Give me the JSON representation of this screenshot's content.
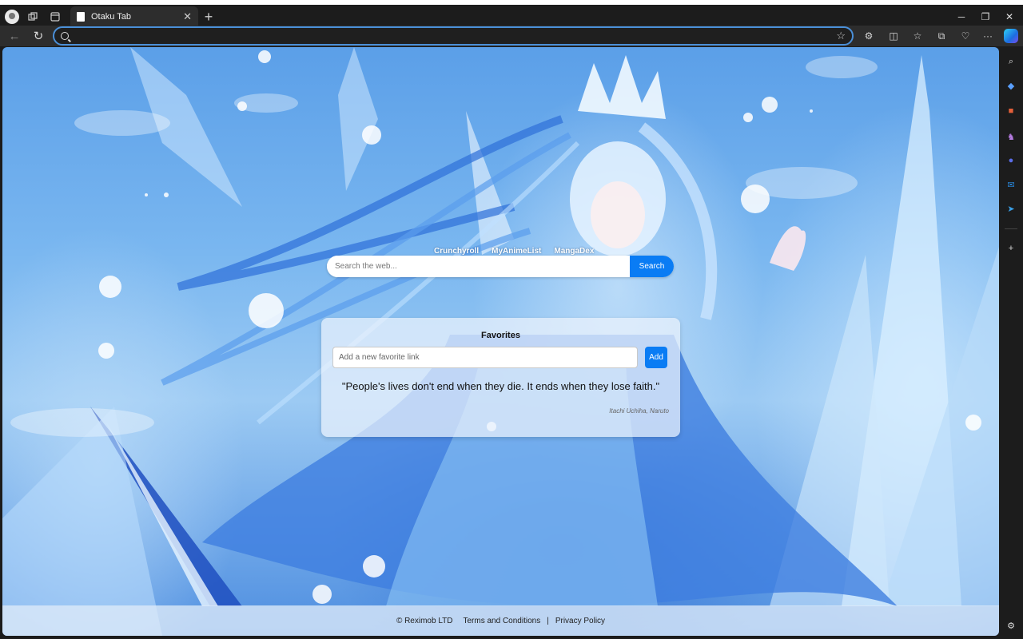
{
  "tab": {
    "title": "Otaku Tab"
  },
  "address_bar": {
    "value": ""
  },
  "page": {
    "quick_links": [
      "Crunchyroll",
      "MyAnimeList",
      "MangaDex"
    ],
    "search": {
      "placeholder": "Search the web...",
      "button": "Search"
    },
    "favorites": {
      "title": "Favorites",
      "input_placeholder": "Add a new favorite link",
      "add_button": "Add"
    },
    "quote": {
      "text": "\"People's lives don't end when they die. It ends when they lose faith.\"",
      "author": "Itachi Uchiha, Naruto"
    },
    "footer": {
      "copyright": "© Reximob LTD",
      "terms": "Terms and Conditions",
      "separator": "|",
      "privacy": "Privacy Policy"
    }
  },
  "colors": {
    "accent": "#0a7cf4",
    "address_border": "#4a8fd8"
  }
}
